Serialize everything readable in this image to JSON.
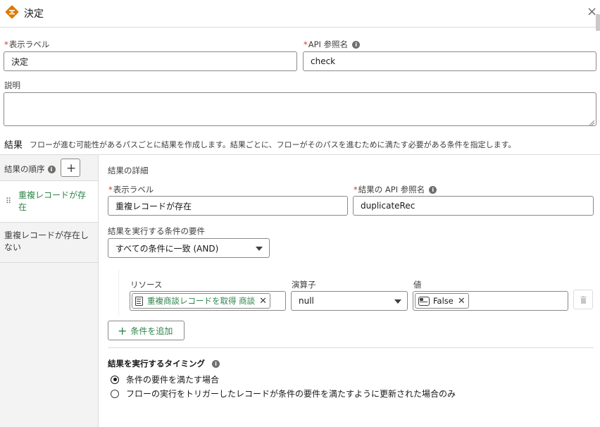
{
  "header": {
    "title": "決定",
    "close_glyph": "×"
  },
  "form": {
    "label_field": {
      "label": "表示ラベル",
      "value": "決定"
    },
    "api_field": {
      "label": "API 参照名",
      "value": "check"
    },
    "description": {
      "label": "説明",
      "value": ""
    }
  },
  "outcomes": {
    "heading": "結果",
    "hint": "フローが進む可能性があるパスごとに結果を作成します。結果ごとに、フローがそのパスを進むために満たす必要がある条件を指定します。",
    "order_label": "結果の順序",
    "items": [
      {
        "label": "重複レコードが存在"
      },
      {
        "label": "重複レコードが存在しない"
      }
    ]
  },
  "detail": {
    "heading": "結果の詳細",
    "label_field": {
      "label": "表示ラベル",
      "value": "重複レコードが存在"
    },
    "api_field": {
      "label": "結果の API 参照名",
      "value": "duplicateRec"
    },
    "condition_req": {
      "label": "結果を実行する条件の要件",
      "value": "すべての条件に一致 (AND)"
    },
    "condition": {
      "resource_label": "リソース",
      "resource_value": "重複商談レコードを取得 商談",
      "operator_label": "演算子",
      "operator_value": "null",
      "value_label": "値",
      "value_value": "False"
    },
    "add_condition": "条件を追加",
    "timing": {
      "heading": "結果を実行するタイミング",
      "options": [
        {
          "label": "条件の要件を満たす場合",
          "selected": true
        },
        {
          "label": "フローの実行をトリガーしたレコードが条件の要件を満たすように更新された場合のみ",
          "selected": false
        }
      ]
    }
  },
  "colors": {
    "accent": "#2e844a",
    "brand_icon": "#dd7a01"
  }
}
